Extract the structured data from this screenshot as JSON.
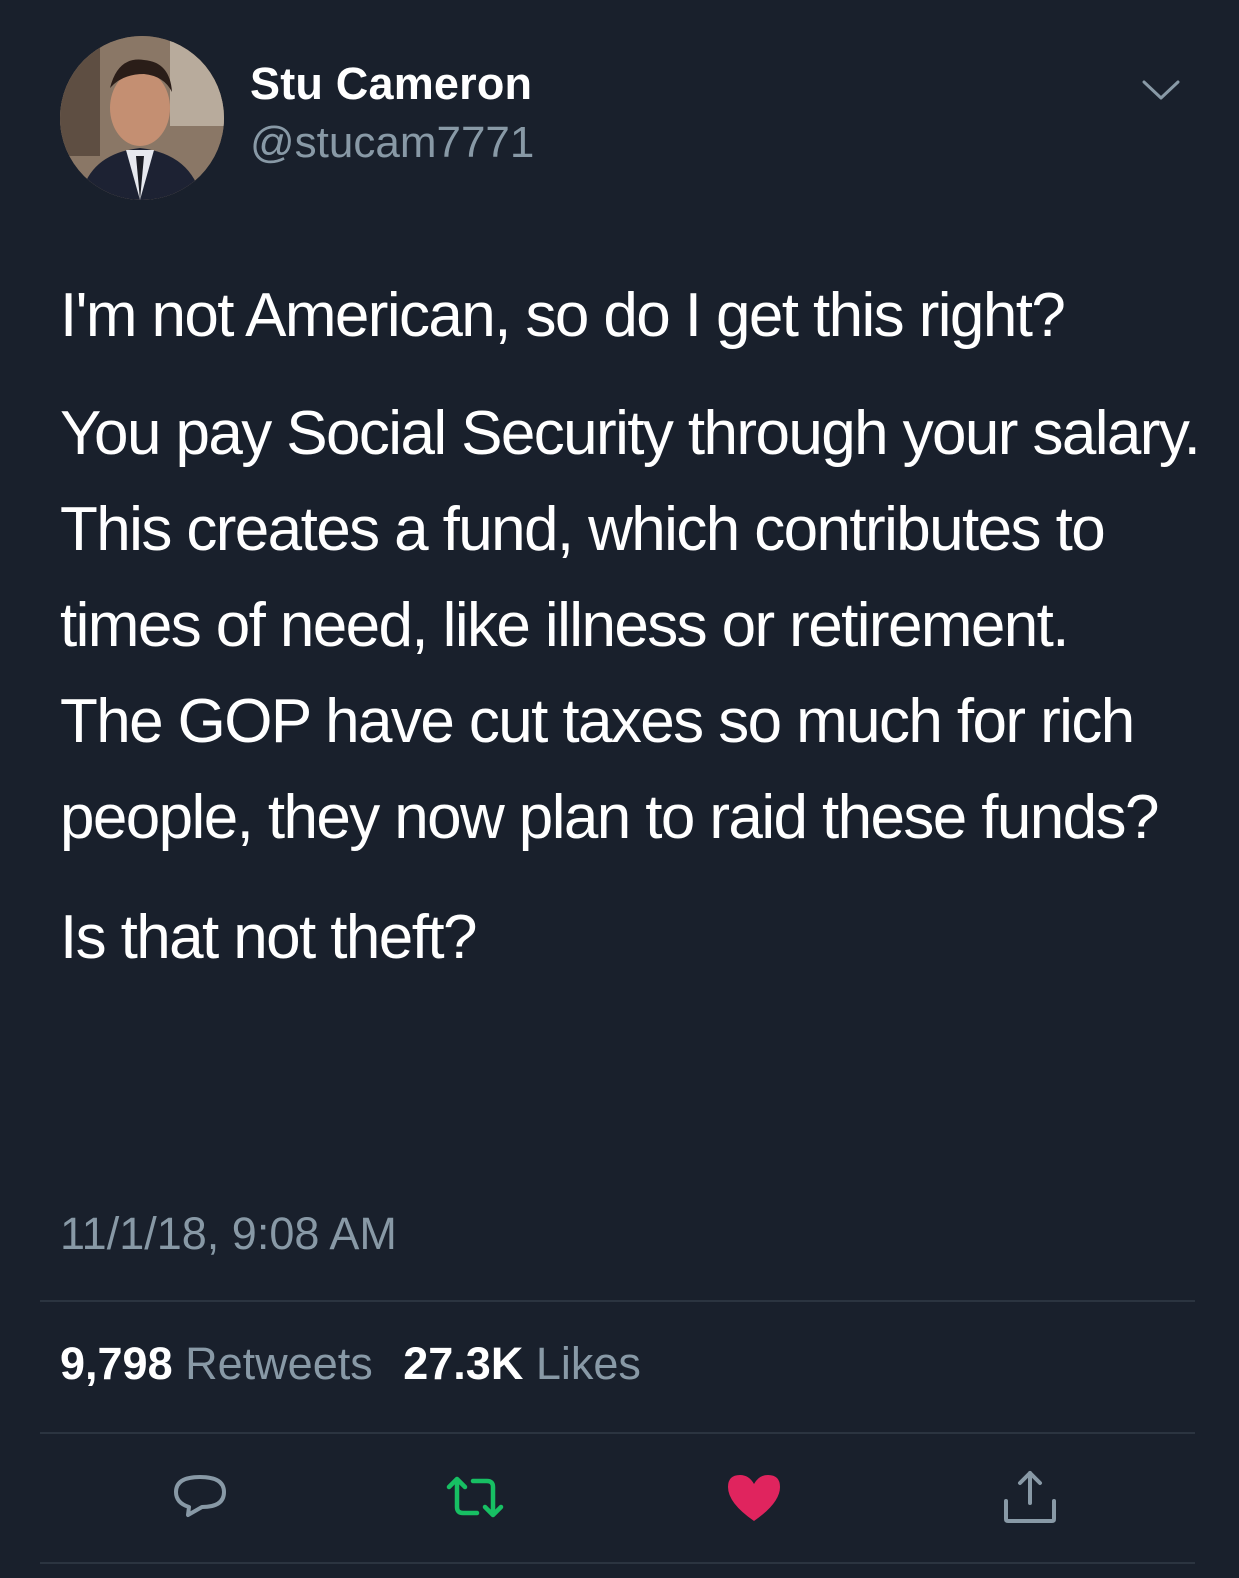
{
  "user": {
    "display_name": "Stu Cameron",
    "handle": "@stucam7771",
    "avatar_icon": "profile-photo",
    "menu_icon": "chevron-down-icon"
  },
  "tweet": {
    "paragraphs": [
      "I'm not American, so do I get this right?",
      "You pay Social Security through your salary.  This creates a fund, which contributes to times of need, like illness or retirement.\nThe GOP have cut taxes so much for rich people, they now plan to raid these funds?",
      "Is that not theft?"
    ],
    "timestamp": "11/1/18, 9:08 AM"
  },
  "stats": {
    "retweets_count": "9,798",
    "retweets_label": "Retweets",
    "likes_count": "27.3K",
    "likes_label": "Likes"
  },
  "actions": {
    "reply_icon": "reply-icon",
    "retweet_icon": "retweet-icon",
    "like_icon": "heart-icon",
    "share_icon": "share-icon",
    "retweet_color": "#17bf63",
    "like_color": "#e0245e",
    "neutral_color": "#8899a6"
  },
  "colors": {
    "background": "#19202c",
    "primary_text": "#ffffff",
    "secondary_text": "#8899a6"
  }
}
